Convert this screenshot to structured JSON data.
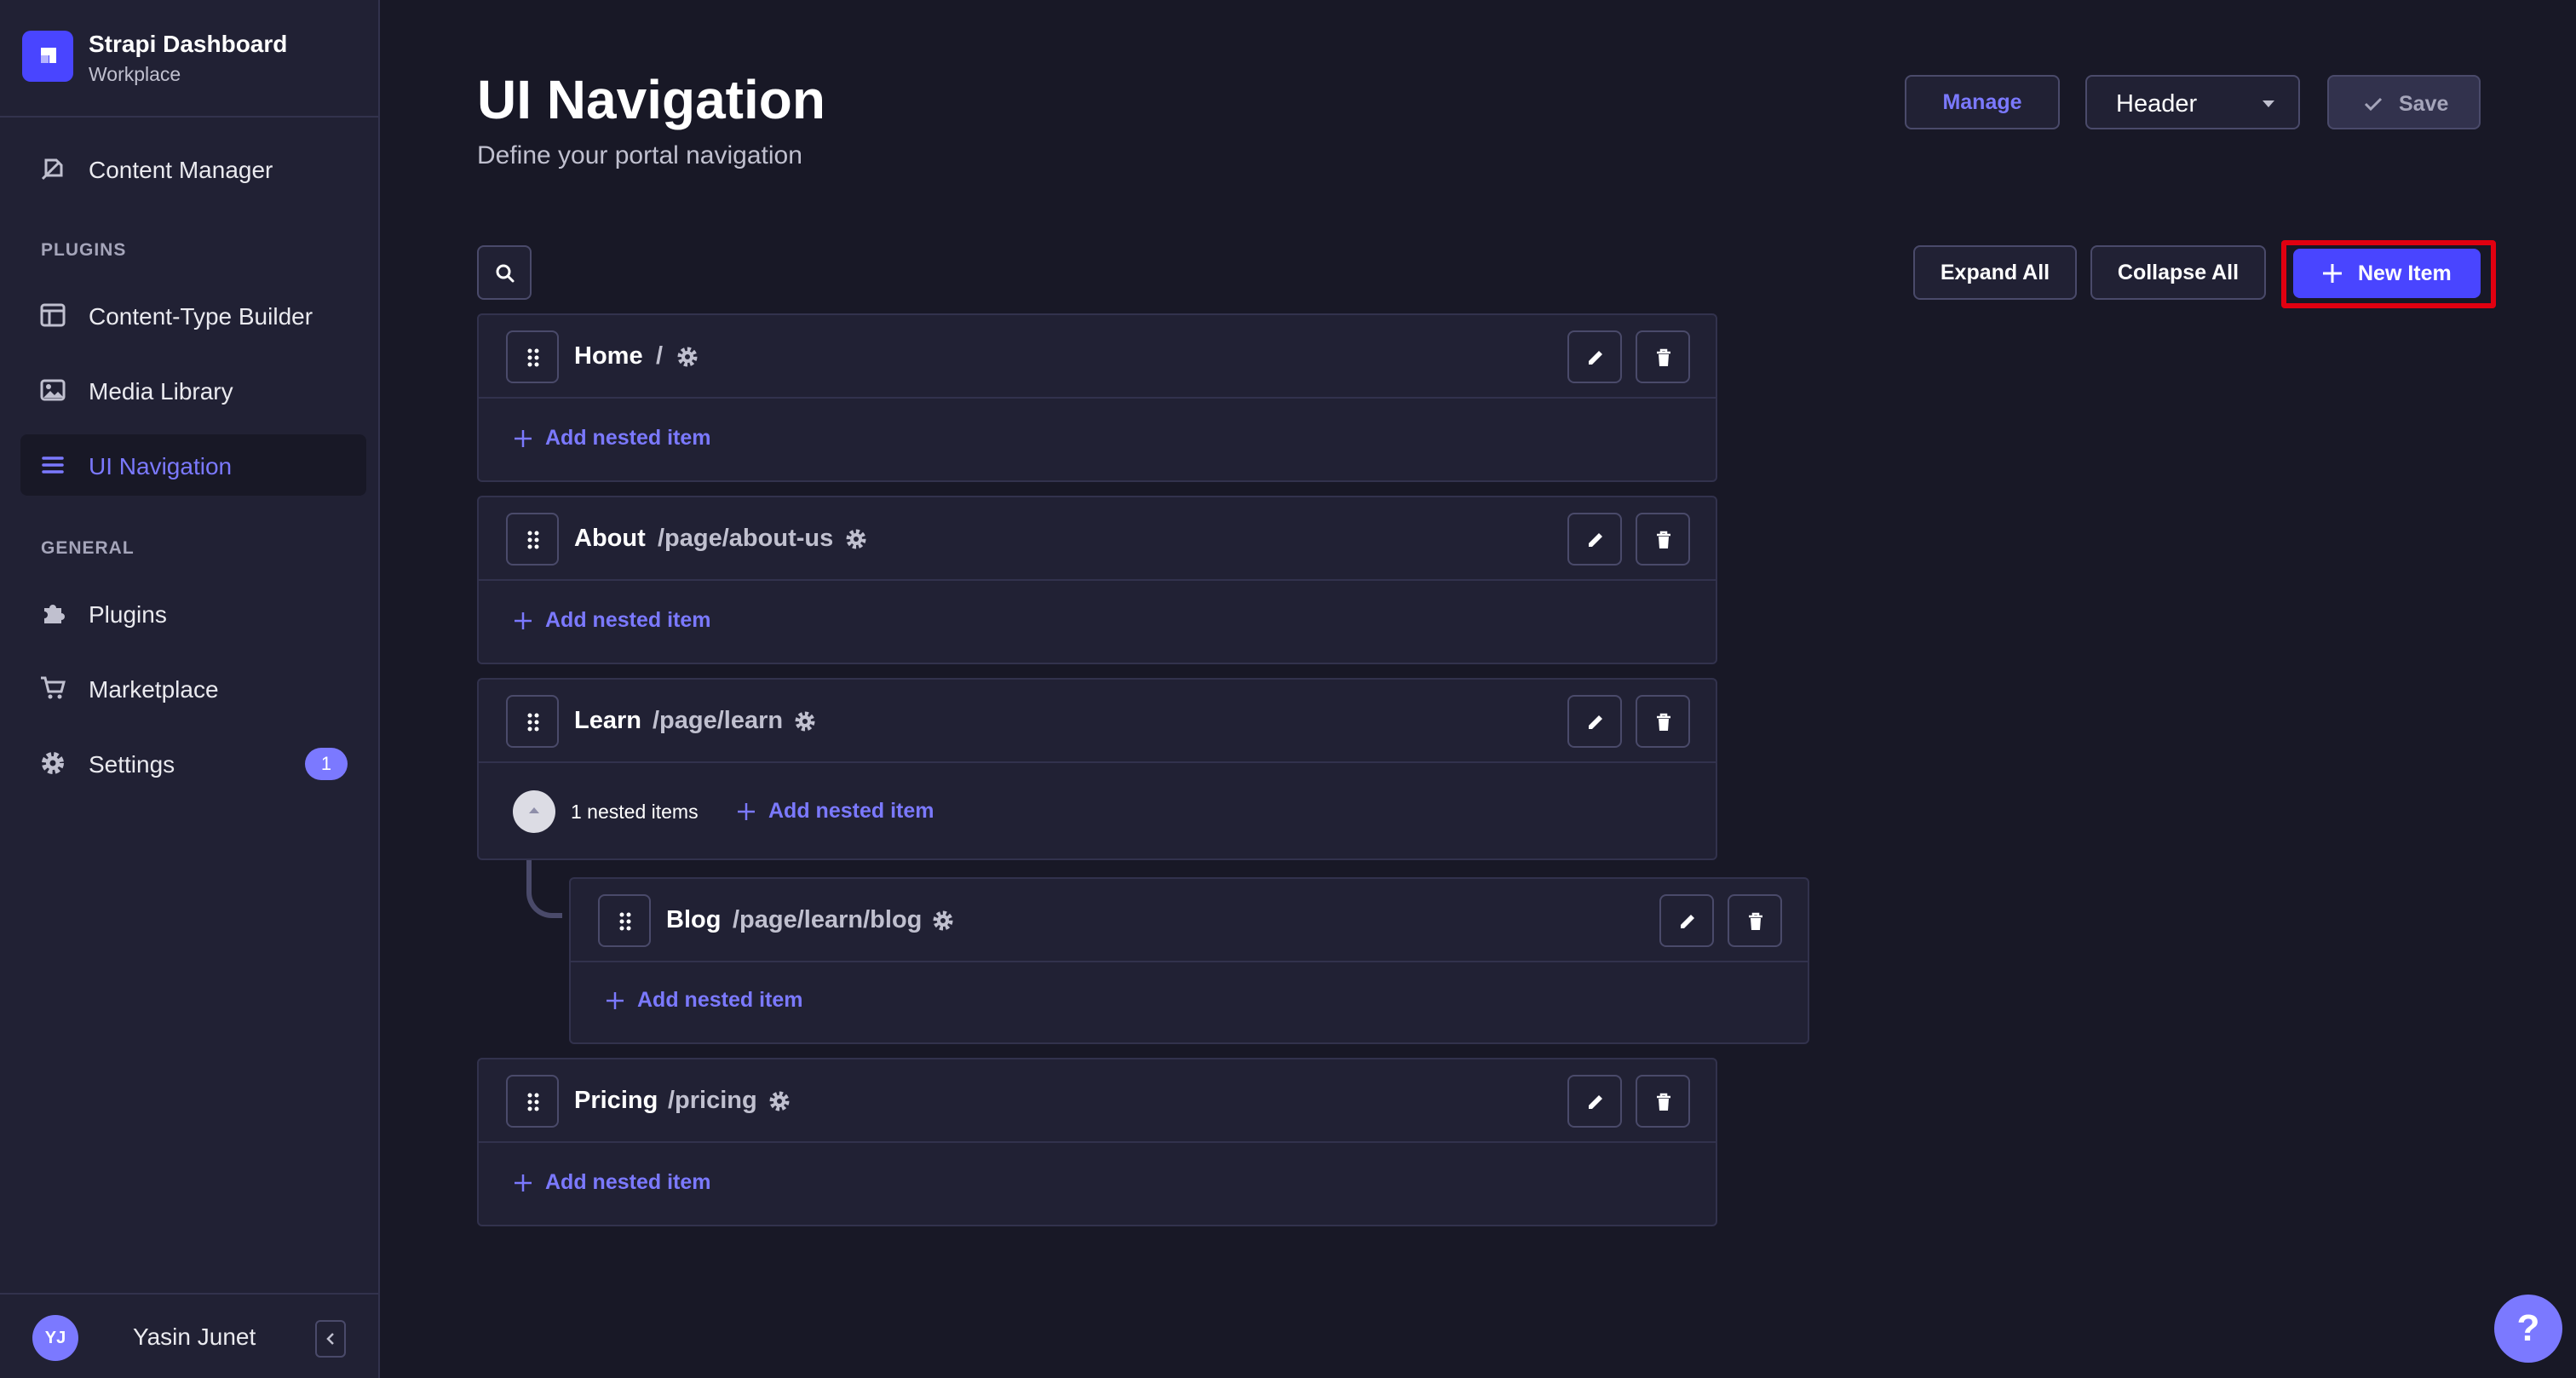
{
  "brand": {
    "title": "Strapi Dashboard",
    "subtitle": "Workplace"
  },
  "sidebar": {
    "content_manager": "Content Manager",
    "plugins_section": "PLUGINS",
    "content_type_builder": "Content-Type Builder",
    "media_library": "Media Library",
    "ui_navigation": "UI Navigation",
    "general_section": "GENERAL",
    "plugins": "Plugins",
    "marketplace": "Marketplace",
    "settings": "Settings",
    "settings_badge": "1"
  },
  "user": {
    "initials": "YJ",
    "name": "Yasin Junet"
  },
  "header": {
    "title": "UI Navigation",
    "subtitle": "Define your portal navigation",
    "manage_label": "Manage",
    "select_value": "Header",
    "save_label": "Save"
  },
  "toolbar": {
    "expand_all": "Expand All",
    "collapse_all": "Collapse All",
    "new_item": "New Item"
  },
  "items": [
    {
      "title": "Home",
      "path": "/",
      "add_nested": "Add nested item"
    },
    {
      "title": "About",
      "path": "/page/about-us",
      "add_nested": "Add nested item"
    },
    {
      "title": "Learn",
      "path": "/page/learn",
      "nested_count": "1 nested items",
      "add_nested": "Add nested item"
    },
    {
      "title": "Blog",
      "path": "/page/learn/blog",
      "add_nested": "Add nested item"
    },
    {
      "title": "Pricing",
      "path": "/pricing",
      "add_nested": "Add nested item"
    }
  ],
  "help_label": "?",
  "colors": {
    "accent": "#7b79ff",
    "primary_button": "#4945ff",
    "highlight": "#e10010",
    "background": "#181826",
    "surface": "#212134"
  }
}
